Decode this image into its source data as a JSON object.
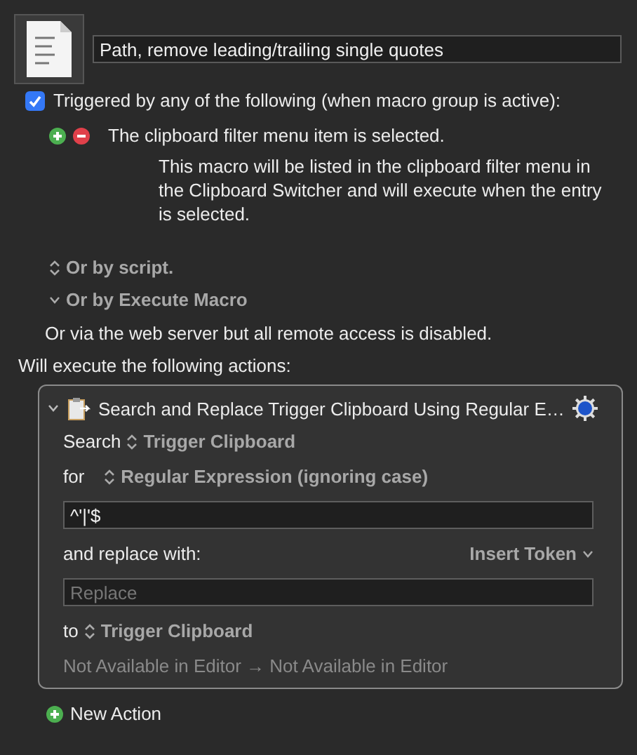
{
  "macro": {
    "name": "Path, remove leading/trailing single quotes"
  },
  "trigger_section": {
    "label": "Triggered by any of the following (when macro group is active):",
    "checked": true
  },
  "triggers": [
    {
      "label": "The clipboard filter menu item is selected.",
      "description": "This macro will be listed in the clipboard filter menu in the Clipboard Switcher and will execute when the entry is selected."
    }
  ],
  "options": [
    {
      "label": "Or by script.",
      "kind": "popup"
    },
    {
      "label": "Or by Execute Macro",
      "kind": "disclosure"
    }
  ],
  "web_server_note": "Or via the web server but all remote access is disabled.",
  "actions_heading": "Will execute the following actions:",
  "action": {
    "title": "Search and Replace Trigger Clipboard Using Regular E…",
    "expanded": true,
    "search_label": "Search",
    "search_source": "Trigger Clipboard",
    "for_label": "for",
    "match_type": "Regular Expression (ignoring case)",
    "pattern": "^'|'$",
    "replace_label": "and replace with:",
    "insert_token": "Insert Token",
    "replace_placeholder": "Replace",
    "to_label": "to",
    "destination": "Trigger Clipboard",
    "preview": "Not Available in Editor → Not Available in Editor"
  },
  "new_action": "New Action"
}
